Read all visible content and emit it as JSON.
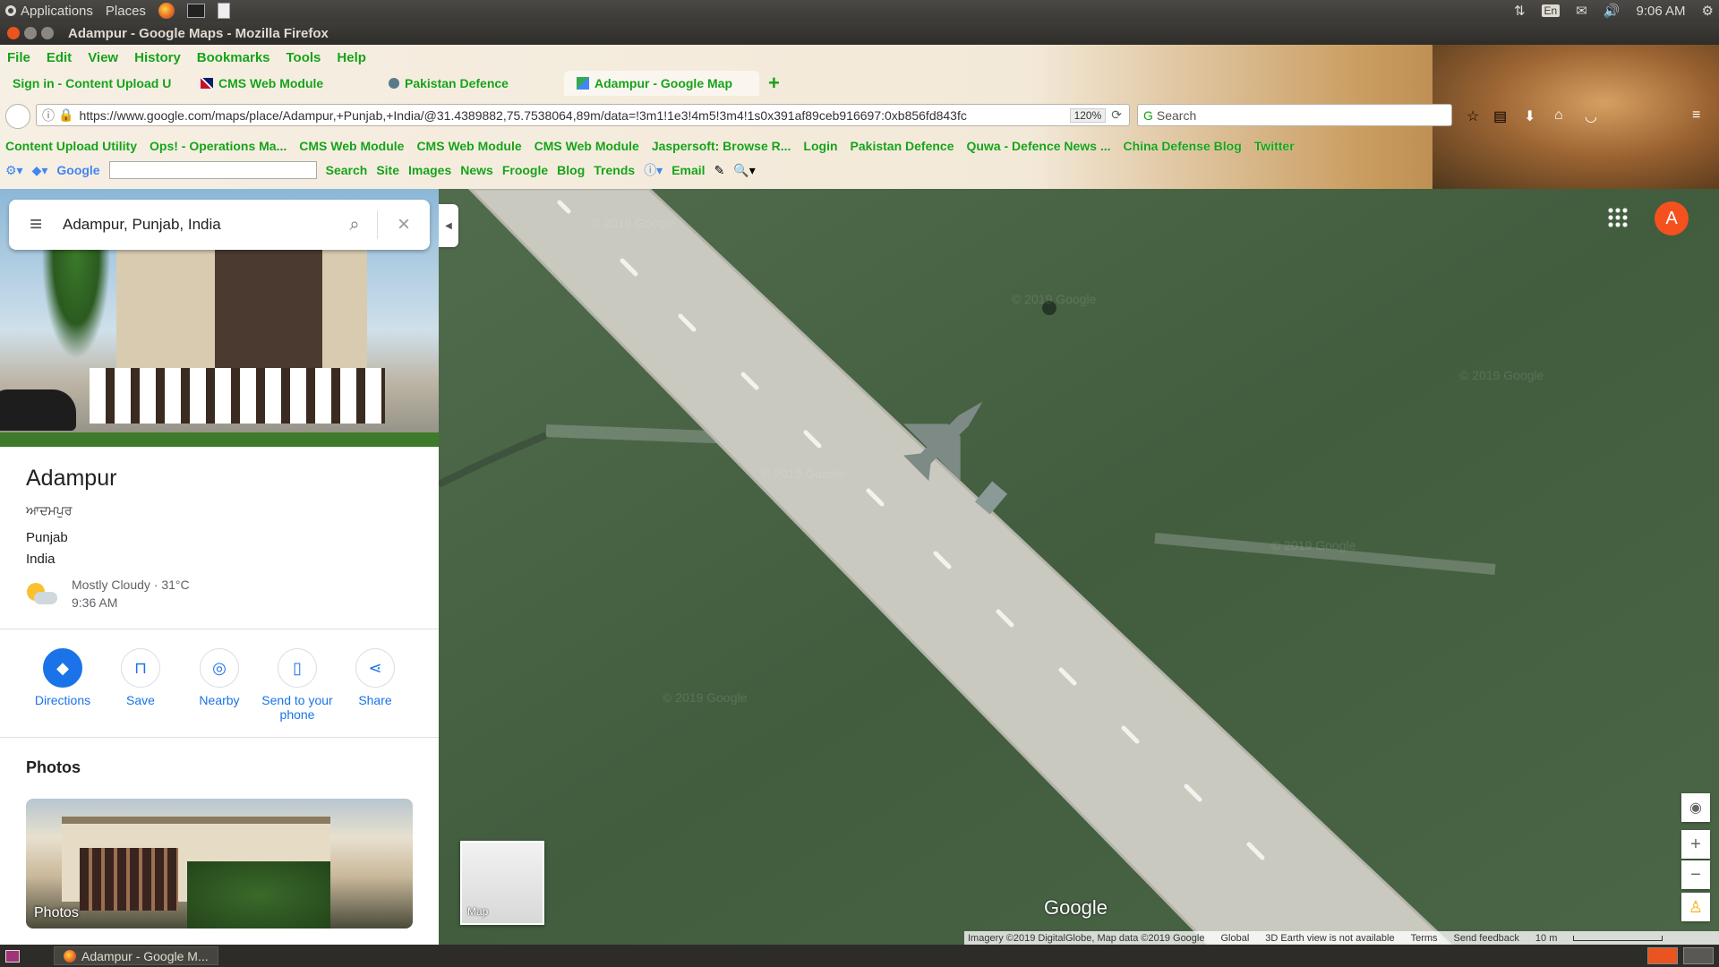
{
  "topbar": {
    "applications": "Applications",
    "places": "Places",
    "lang": "En",
    "time": "9:06 AM"
  },
  "window": {
    "title": "Adampur - Google Maps - Mozilla Firefox"
  },
  "menu": [
    "File",
    "Edit",
    "View",
    "History",
    "Bookmarks",
    "Tools",
    "Help"
  ],
  "tabs": [
    {
      "label": "Sign in - Content Upload U"
    },
    {
      "label": "CMS Web Module"
    },
    {
      "label": "Pakistan Defence"
    },
    {
      "label": "Adampur - Google Map"
    }
  ],
  "url": {
    "value": "https://www.google.com/maps/place/Adampur,+Punjab,+India/@31.4389882,75.7538064,89m/data=!3m1!1e3!4m5!3m4!1s0x391af89ceb916697:0xb856fd843fc",
    "zoom": "120%",
    "search_placeholder": "Search"
  },
  "bookmarks": [
    "Content Upload Utility",
    "Ops! - Operations Ma...",
    "CMS Web Module",
    "CMS Web Module",
    "CMS Web Module",
    "Jaspersoft: Browse R...",
    "Login",
    "Pakistan Defence",
    "Quwa - Defence News ...",
    "China Defense Blog",
    "Twitter"
  ],
  "google_toolbar": {
    "brand": "Google",
    "items": [
      "Search",
      "Site",
      "Images",
      "News",
      "Froogle",
      "Blog",
      "Trends",
      "Email"
    ]
  },
  "maps": {
    "search_value": "Adampur, Punjab, India",
    "place_name": "Adampur",
    "place_native": "ਆਦਮਪੁਰ",
    "region": "Punjab",
    "country": "India",
    "weather": "Mostly Cloudy · 31°C",
    "weather_time": "9:36 AM",
    "actions": [
      "Directions",
      "Save",
      "Nearby",
      "Send to your phone",
      "Share"
    ],
    "photos_heading": "Photos",
    "photos_label": "Photos",
    "map_toggle_label": "Map",
    "avatar_letter": "A",
    "logo": "Google",
    "watermark": "© 2019 Google",
    "attribution": {
      "imagery": "Imagery ©2019 DigitalGlobe, Map data ©2019 Google",
      "global": "Global",
      "earth": "3D Earth view is not available",
      "terms": "Terms",
      "feedback": "Send feedback",
      "scale": "10 m"
    }
  },
  "taskbar": {
    "window_label": "Adampur - Google M..."
  },
  "colors": {
    "bookmark_green": "#16a216",
    "maps_blue": "#1a73e8",
    "avatar": "#f4511e",
    "grass": "#42603f",
    "runway": "#c9c9c0"
  }
}
